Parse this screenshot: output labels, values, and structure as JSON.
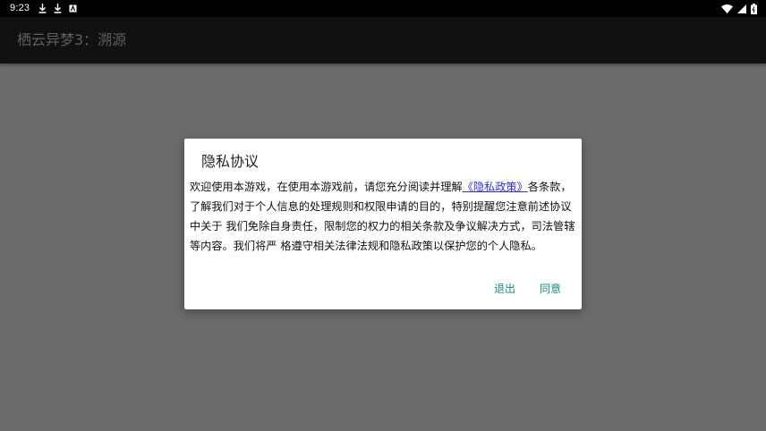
{
  "status_bar": {
    "time": "9:23",
    "left_icons": [
      "download-icon",
      "download-icon",
      "app-notification-icon"
    ],
    "right_icons": [
      "wifi-icon",
      "signal-icon",
      "battery-icon"
    ]
  },
  "app_bar": {
    "title": "栖云异梦3：溯源"
  },
  "dialog": {
    "title": "隐私协议",
    "body_pre": "欢迎使用本游戏，在使用本游戏前，请您充分阅读并理解",
    "link_text": "《隐私政策》",
    "body_post": "各条款，了解我们对于个人信息的处理规则和权限申请的目的，特别提醒您注意前述协议中关于 我们免除自身责任，限制您的权力的相关条款及争议解决方式，司法管辖等内容。我们将严 格遵守相关法律法规和隐私政策以保护您的个人隐私。",
    "exit_label": "退出",
    "agree_label": "同意"
  },
  "colors": {
    "background_dim": "#6b6b6b",
    "status_bar": "#000000",
    "app_bar": "#111111",
    "link": "#2f2fd8",
    "button_accent": "#1a8a82"
  }
}
